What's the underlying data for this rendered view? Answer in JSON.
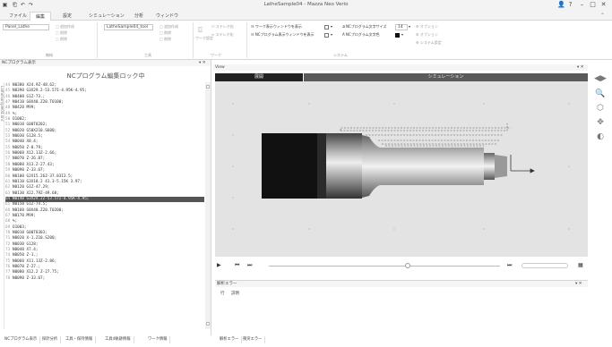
{
  "window": {
    "title": "LatheSample04 - Mazza Neo Verio",
    "quick_access": [
      "▣",
      "⎗",
      "↶",
      "↷"
    ],
    "controls": [
      "👤",
      "?",
      "–",
      "□",
      "✕"
    ]
  },
  "menu": {
    "items": [
      "ファイル",
      "編集",
      "設定",
      "シミュレーション",
      "分析",
      "ウィンドウ"
    ],
    "active_index": 1
  },
  "ribbon": {
    "group1": {
      "dropdown": "Panel_Lathe",
      "buttons": [
        "追加作成",
        "削除",
        "削除"
      ],
      "label": "機械"
    },
    "group2": {
      "dropdown": "LatheSample04_tool",
      "buttons": [
        "追加作成",
        "削除",
        "削除"
      ],
      "label": "工具"
    },
    "group3": {
      "button": "ワーク設定",
      "buttons": [
        "ステレオ化",
        "ステレオ化"
      ],
      "label": "ワーク"
    },
    "group4": {
      "rows": [
        {
          "text": "ワーク表示ウィンドウを表示",
          "box": "□",
          "text2": "NCプログラム文字サイズ",
          "size": "14",
          "extra": "オプション"
        },
        {
          "text": "NCプログラム表示ウィンドウを表示",
          "box": "□",
          "text2": "NCプログラム文字色",
          "extra": "オプション"
        }
      ],
      "extra3": "システム設定",
      "label": "システム"
    }
  },
  "nc_panel": {
    "title": "NCプログラム表示",
    "lock_text": "NCプログラム編集ロック中",
    "gutter_label": "LatheSample04.dnc",
    "lines": [
      {
        "n": "44",
        "code": "N0380 X24.9Z-48.62;"
      },
      {
        "n": "45",
        "code": "N0390 G3X29.2-53.57I-4.95K-4.95;"
      },
      {
        "n": "46",
        "code": "N0400 G1Z-73.;"
      },
      {
        "n": "47",
        "code": "N0410 G0X40.Z20.T0100;"
      },
      {
        "n": "48",
        "code": "N0420 M99;"
      },
      {
        "n": "49",
        "code": "%;"
      },
      {
        "n": "50",
        "code": "O1002;"
      },
      {
        "n": "51",
        "code": "N0010 G00T0202;"
      },
      {
        "n": "52",
        "code": "N0020 G50X210.S600;"
      },
      {
        "n": "53",
        "code": "N0030 G128.5;"
      },
      {
        "n": "54",
        "code": "N0040 X8.4;"
      },
      {
        "n": "55",
        "code": "N0050 Z-0.79;"
      },
      {
        "n": "56",
        "code": "N0060 X12.13Z-2.66;"
      },
      {
        "n": "57",
        "code": "N0070 Z-26.87;"
      },
      {
        "n": "58",
        "code": "N0080 X13.Z-27.43;"
      },
      {
        "n": "59",
        "code": "N0090 Z-33.67;"
      },
      {
        "n": "60",
        "code": "N0100 G2X15.26Z-37.83I3.5;"
      },
      {
        "n": "61",
        "code": "N0110 G3X18.2 41.3-5.15K 3.97;"
      },
      {
        "n": "62",
        "code": "N0120 G1Z-47.29;"
      },
      {
        "n": "63",
        "code": "N0130 X22.79Z-49.68;"
      },
      {
        "n": "64",
        "code": "N0140 G3X24.2Z-53.57I-4.95K-4.95;"
      },
      {
        "n": "65",
        "code": "N0150 G1Z-74.5;"
      },
      {
        "n": "66",
        "code": "N0160 G0X40.Z20.T0200;"
      },
      {
        "n": "67",
        "code": "N0170 M99;"
      },
      {
        "n": "68",
        "code": "%;"
      },
      {
        "n": "69",
        "code": "O1003;"
      },
      {
        "n": "70",
        "code": "N0010 G00T0303;"
      },
      {
        "n": "71",
        "code": "N0020 X-1.Z10.S200;"
      },
      {
        "n": "72",
        "code": "N0030 G128;"
      },
      {
        "n": "73",
        "code": "N0040 X7.4;"
      },
      {
        "n": "74",
        "code": "N0050 Z-1.;"
      },
      {
        "n": "75",
        "code": "N0060 X11.13Z-2.86;"
      },
      {
        "n": "76",
        "code": "N0070 Z-27.;"
      },
      {
        "n": "77",
        "code": "N0080 X12.2 Z-27.75;"
      },
      {
        "n": "78",
        "code": "N0090 Z-33.67;"
      }
    ],
    "highlight_index": 20
  },
  "bottom_tabs_left": [
    "NCプログラム表示",
    "探針分析",
    "工具・保持情報",
    "工具4軌跡情報",
    "ワーク情報"
  ],
  "view": {
    "title": "View",
    "tabs": [
      "展開",
      "シミュレーション"
    ]
  },
  "playback": {
    "buttons": [
      "▶",
      "⏮",
      "⏭",
      "⏭",
      "▦"
    ],
    "progress": 0.6
  },
  "error_panel": {
    "title": "解析エラー",
    "columns": [
      "行",
      "説明"
    ]
  },
  "bottom_tabs_right": [
    "解析エラー",
    "衝突エラー"
  ],
  "right_tools": [
    "◀▶",
    "🔍",
    "⬡",
    "✥",
    "◐"
  ]
}
